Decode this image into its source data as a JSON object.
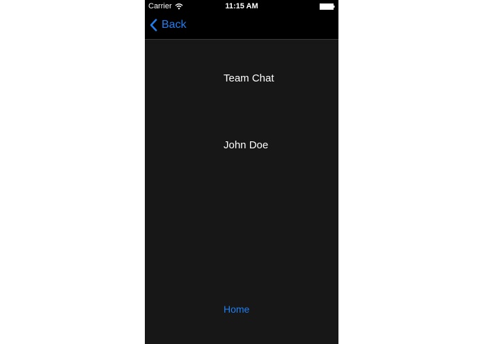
{
  "status_bar": {
    "carrier": "Carrier",
    "time": "11:15 AM",
    "wifi_icon": "wifi-icon",
    "battery_icon": "battery-icon"
  },
  "nav": {
    "back_label": "Back",
    "back_icon": "chevron-left-icon"
  },
  "content": {
    "group_name": "Team Chat",
    "user_name": "John Doe",
    "home_link": "Home"
  },
  "colors": {
    "background": "#171717",
    "bar": "#000000",
    "accent": "#1f7ef0",
    "text": "#ffffff"
  }
}
